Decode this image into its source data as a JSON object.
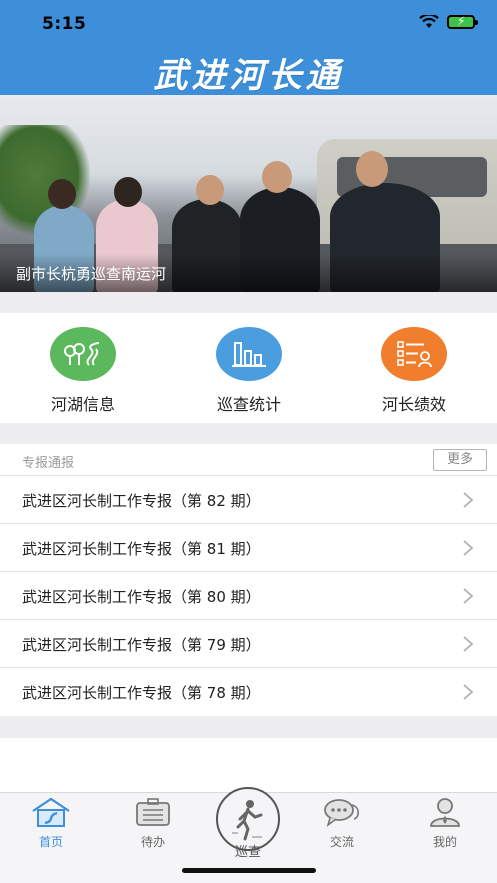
{
  "status_bar": {
    "time": "5:15"
  },
  "header": {
    "app_title": "武进河长通"
  },
  "banner": {
    "caption": "副市长杭勇巡查南运河"
  },
  "quick_menu": [
    {
      "label": "河湖信息",
      "icon": "river-lake-icon",
      "color": "#5cb85c"
    },
    {
      "label": "巡查统计",
      "icon": "bar-chart-icon",
      "color": "#4a9ee0"
    },
    {
      "label": "河长绩效",
      "icon": "checklist-icon",
      "color": "#f07e2c"
    }
  ],
  "reports": {
    "title": "专报通报",
    "more_label": "更多",
    "items": [
      {
        "label": "武进区河长制工作专报（第 82 期）"
      },
      {
        "label": "武进区河长制工作专报（第 81 期）"
      },
      {
        "label": "武进区河长制工作专报（第 80 期）"
      },
      {
        "label": "武进区河长制工作专报（第 79 期）"
      },
      {
        "label": "武进区河长制工作专报（第 78 期）"
      }
    ]
  },
  "tabbar": {
    "home": "首页",
    "todo": "待办",
    "patrol": "巡查",
    "chat": "交流",
    "mine": "我的"
  },
  "colors": {
    "primary": "#3d8fd9",
    "green": "#5cb85c",
    "blue": "#4a9ee0",
    "orange": "#f07e2c"
  }
}
